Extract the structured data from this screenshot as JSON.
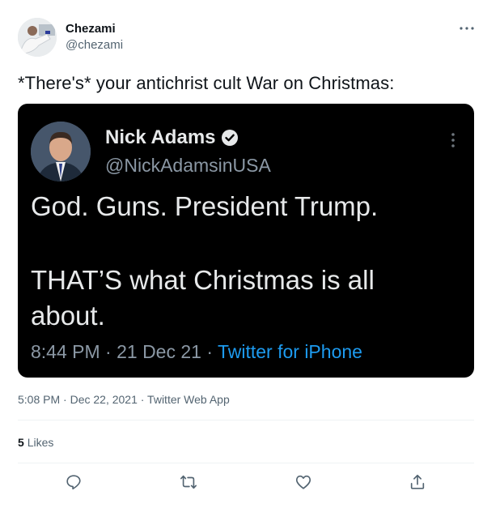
{
  "author": {
    "display_name": "Chezami",
    "handle": "@chezami"
  },
  "tweet": {
    "text": "*There's* your antichrist cult War on Christmas:",
    "timestamp": "5:08 PM · Dec 22, 2021 · Twitter Web App",
    "likes_count": "5",
    "likes_label": "Likes"
  },
  "embedded_tweet": {
    "display_name": "Nick Adams",
    "handle": "@NickAdamsinUSA",
    "line1": "God. Guns. President Trump.",
    "line2": "THAT’S what Christmas is all about.",
    "meta_time": "8:44 PM · 21 Dec 21 · ",
    "meta_source": "Twitter for iPhone"
  },
  "actions": [
    {
      "icon": "reply-icon"
    },
    {
      "icon": "retweet-icon"
    },
    {
      "icon": "like-icon"
    },
    {
      "icon": "share-icon"
    }
  ],
  "colors": {
    "text_primary": "#0f1419",
    "text_secondary": "#536471",
    "link_blue": "#1d9bf0",
    "embed_bg": "#000000"
  }
}
